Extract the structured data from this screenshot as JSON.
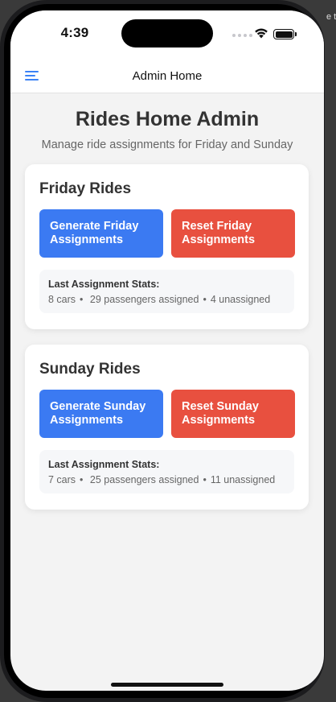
{
  "status_bar": {
    "time": "4:39"
  },
  "nav": {
    "title": "Admin Home",
    "menu_icon": "hamburger-menu-icon"
  },
  "page": {
    "title": "Rides Home Admin",
    "subtitle": "Manage ride assignments for Friday and Sunday"
  },
  "friday": {
    "title": "Friday Rides",
    "generate_label": "Generate Friday Assignments",
    "reset_label": "Reset Friday Assignments",
    "stats_label": "Last Assignment Stats:",
    "cars": "8 cars",
    "passengers": "29 passengers assigned",
    "unassigned": "4 unassigned"
  },
  "sunday": {
    "title": "Sunday Rides",
    "generate_label": "Generate Sunday Assignments",
    "reset_label": "Reset Sunday Assignments",
    "stats_label": "Last Assignment Stats:",
    "cars": "7 cars",
    "passengers": "25 passengers assigned",
    "unassigned": "11 unassigned"
  },
  "colors": {
    "accent": "#3b7af2",
    "danger": "#e8503f",
    "background": "#f3f3f3"
  },
  "peek_text": "e th"
}
